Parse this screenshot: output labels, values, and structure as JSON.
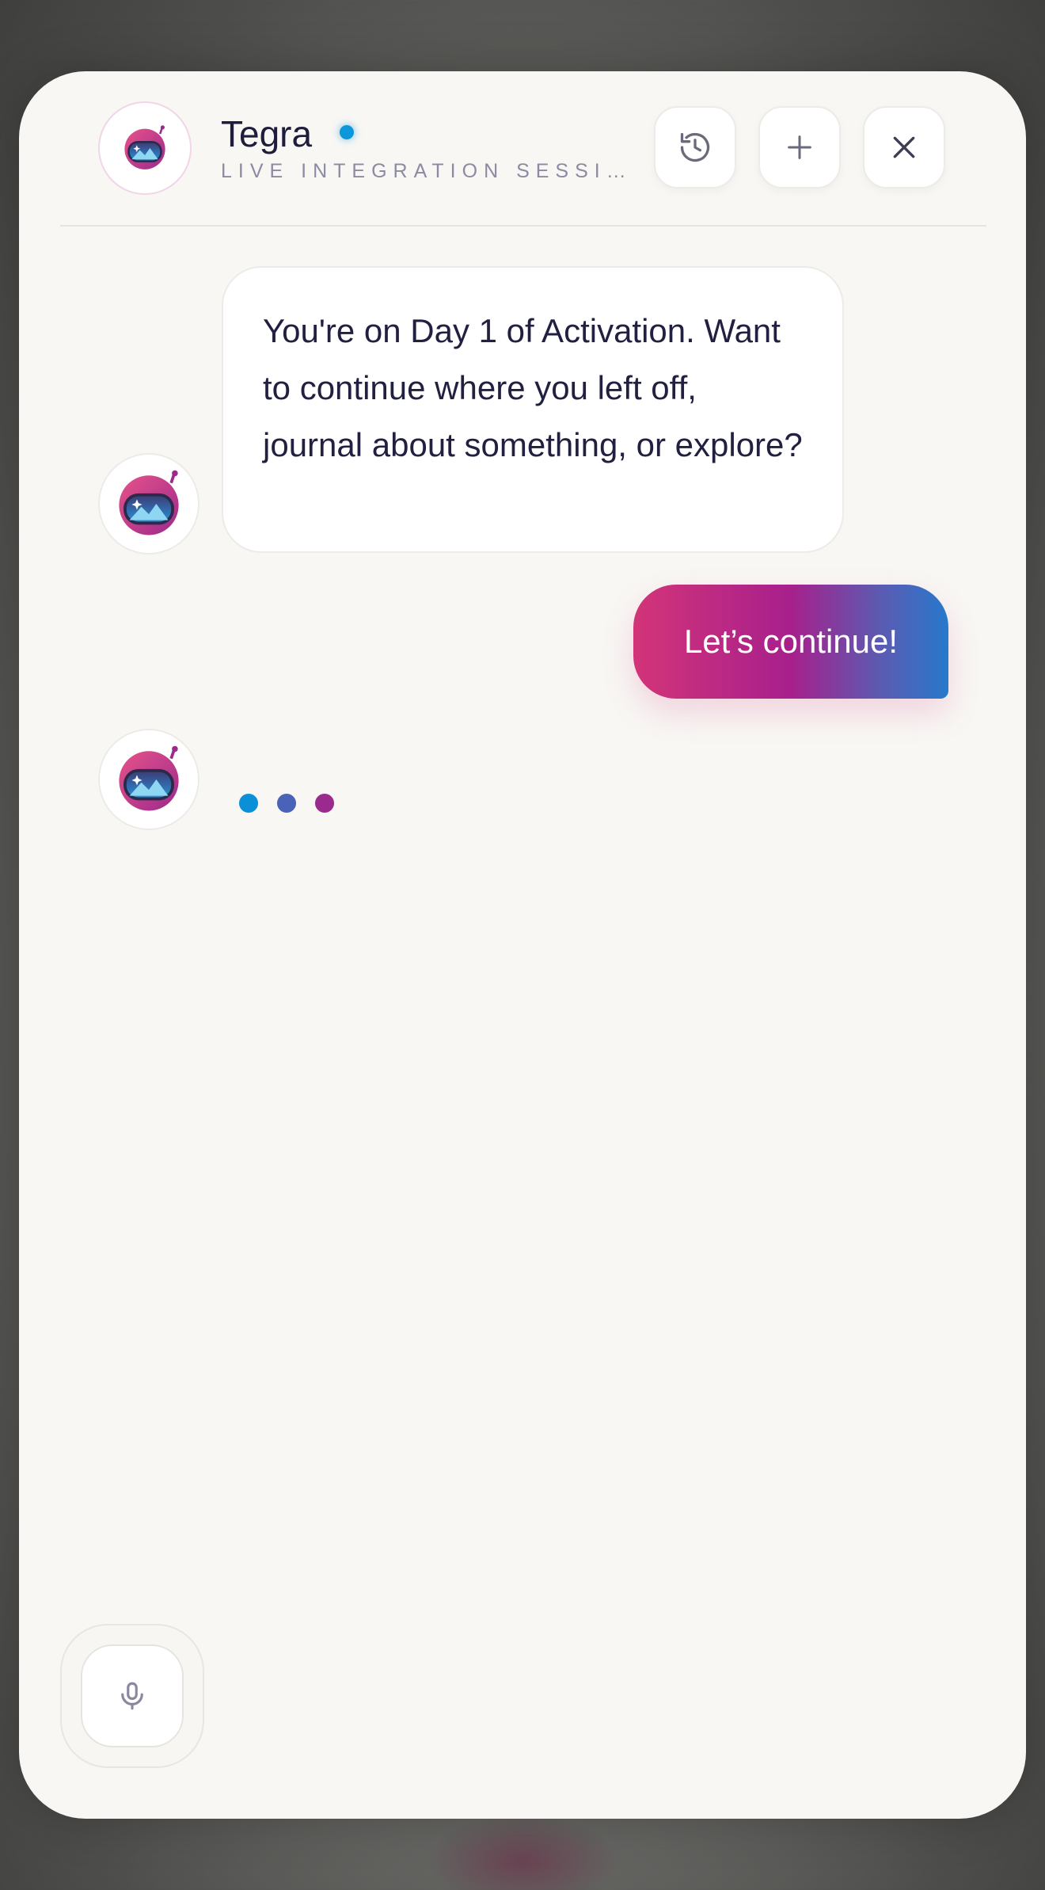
{
  "header": {
    "title": "Tegra",
    "subtitle": "LIVE INTEGRATION SESSION",
    "status": "online",
    "buttons": {
      "history_icon": "history-icon",
      "add_icon": "plus-icon",
      "close_icon": "close-icon"
    }
  },
  "messages": [
    {
      "role": "assistant",
      "text": "You're on Day 1 of Activation. Want to continue where you left off, journal about something, or explore?"
    },
    {
      "role": "user",
      "text": "Let’s continue!"
    },
    {
      "role": "assistant",
      "typing": true
    }
  ],
  "composer": {
    "mic_icon": "microphone-icon"
  },
  "colors": {
    "accent_pink": "#d33478",
    "accent_purple": "#a7208c",
    "accent_blue": "#2779cc",
    "status_dot": "#0b97d9",
    "text_dark": "#1e1d3c"
  }
}
